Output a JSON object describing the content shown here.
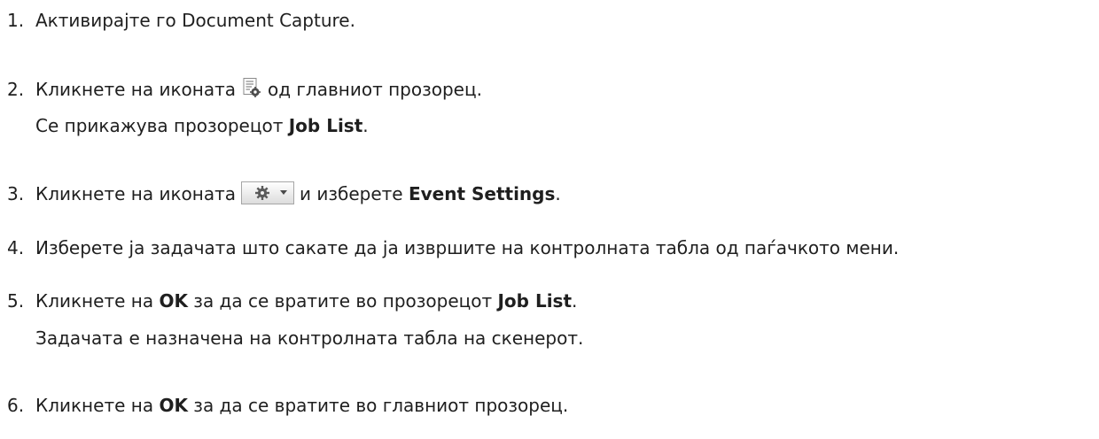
{
  "steps": [
    {
      "number": "1.",
      "text": "Активирајте го Document Capture."
    },
    {
      "number": "2.",
      "text_before": "Кликнете на иконата",
      "icon": "job-list-icon",
      "text_after": "од главниот прозорец.",
      "result_before": "Се прикажува прозорецот ",
      "result_bold": "Job List",
      "result_after": "."
    },
    {
      "number": "3.",
      "text_before": "Кликнете на иконата",
      "icon": "settings-gear-dropdown-icon",
      "text_middle": "и изберете ",
      "text_bold": "Event Settings",
      "text_after": "."
    },
    {
      "number": "4.",
      "text": "Изберете ја задачата што сакате да ја извршите на контролната табла од паѓачкото мени."
    },
    {
      "number": "5.",
      "text_before": "Кликнете на ",
      "bold1": "OK",
      "text_middle": " за да се вратите во прозорецот ",
      "bold2": "Job List",
      "text_after": ".",
      "result": "Задачата е назначена на контролната табла на скенерот."
    },
    {
      "number": "6.",
      "text_before": "Кликнете на ",
      "bold1": "OK",
      "text_after": " за да се вратите во главниот прозорец."
    }
  ]
}
